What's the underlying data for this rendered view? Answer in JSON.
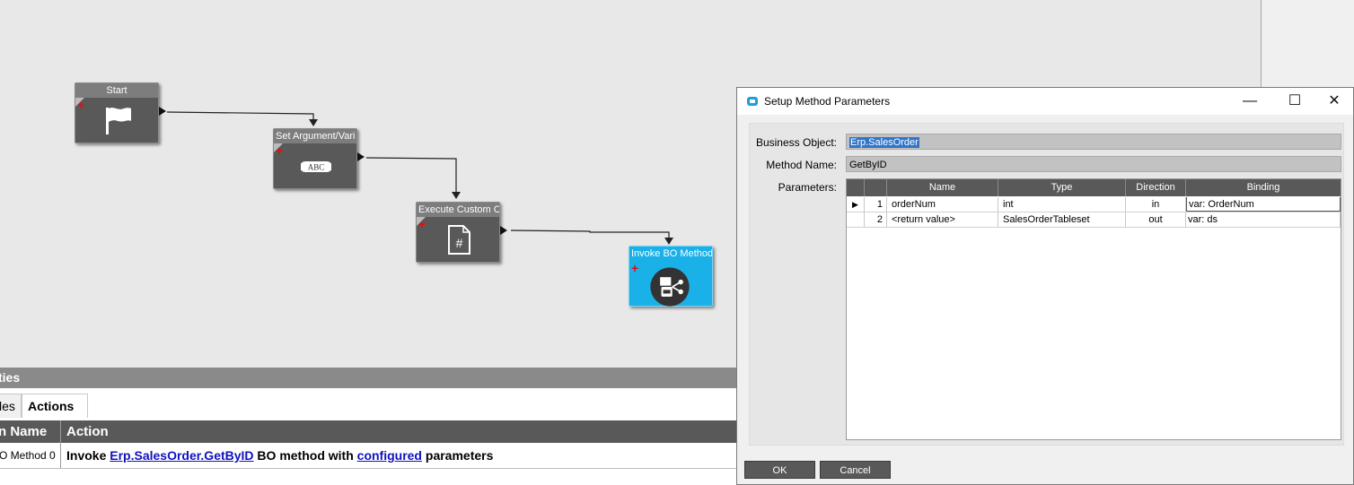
{
  "workflow": {
    "nodes": [
      {
        "id": "start",
        "title": "Start",
        "icon": "flag-icon"
      },
      {
        "id": "set-arg",
        "title": "Set Argument/Vari",
        "icon": "abc-icon",
        "icon_text": "ABC"
      },
      {
        "id": "exec-code",
        "title": "Execute Custom Co",
        "icon": "code-file-icon",
        "icon_text": "#"
      },
      {
        "id": "invoke-bo",
        "title": "Invoke BO Method",
        "icon": "bo-method-icon"
      }
    ],
    "colors": {
      "node": "#595959",
      "node_selected": "#1ab0e8",
      "add_marker": "#e01010"
    }
  },
  "properties": {
    "title_fragment": "ties",
    "tabs": [
      {
        "label": "les",
        "active": false
      },
      {
        "label": "Actions",
        "active": true
      }
    ],
    "columns": [
      "n Name",
      "Action"
    ],
    "row": {
      "name": "O Method 0",
      "action_prefix": "Invoke ",
      "action_link1": "Erp.SalesOrder.GetByID",
      "action_middle": " BO method with ",
      "action_link2": "configured",
      "action_suffix": " parameters"
    }
  },
  "dialog": {
    "title": "Setup Method Parameters",
    "window_buttons": {
      "minimize": "—",
      "maximize": "☐",
      "close": "✕"
    },
    "business_object_label": "Business Object:",
    "business_object_value": "Erp.SalesOrder",
    "method_name_label": "Method Name:",
    "method_name_value": "GetByID",
    "parameters_label": "Parameters:",
    "grid": {
      "columns": [
        "Name",
        "Type",
        "Direction",
        "Binding"
      ],
      "rows": [
        {
          "indicator": "▶",
          "num": "1",
          "name": "orderNum",
          "type": "int",
          "direction": "in",
          "binding": "var: OrderNum"
        },
        {
          "indicator": "",
          "num": "2",
          "name": "<return value>",
          "type": "SalesOrderTableset",
          "direction": "out",
          "binding": "var: ds"
        }
      ]
    },
    "ok_label": "OK",
    "cancel_label": "Cancel"
  }
}
